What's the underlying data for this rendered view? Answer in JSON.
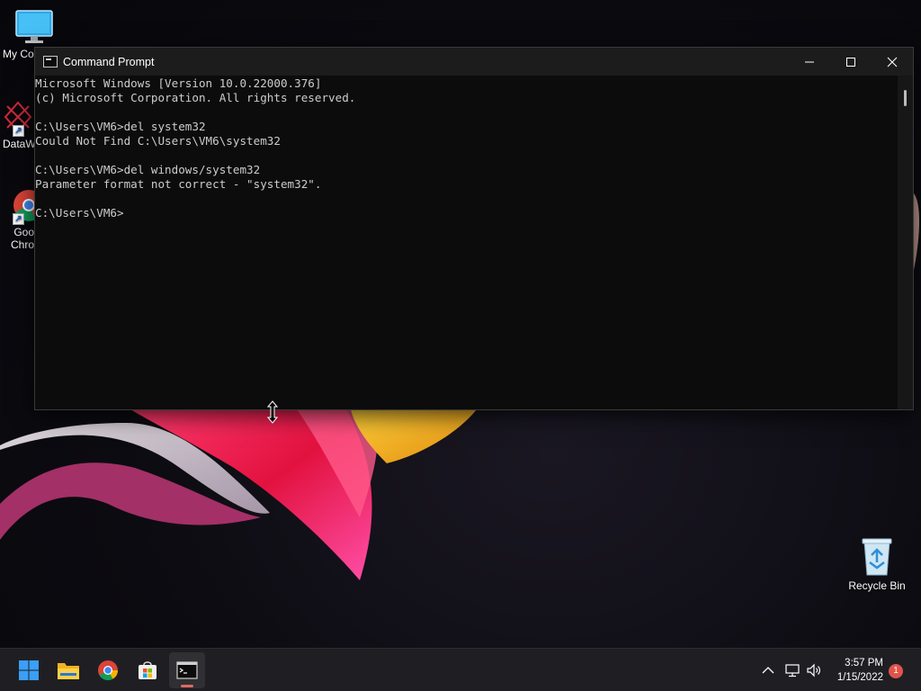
{
  "desktop": {
    "icons": [
      {
        "label": "My Co",
        "icon": "computer-icon"
      },
      {
        "label": "DataW",
        "icon": "datawrapper-icon"
      },
      {
        "label": "Goo",
        "label2": "Chro",
        "icon": "chrome-icon"
      },
      {
        "label": "Recycle Bin",
        "icon": "recycle-bin-icon"
      }
    ]
  },
  "window": {
    "title": "Command Prompt",
    "controls": [
      "minimize",
      "maximize",
      "close"
    ],
    "lines": [
      "Microsoft Windows [Version 10.0.22000.376]",
      "(c) Microsoft Corporation. All rights reserved.",
      "",
      "C:\\Users\\VM6>del system32",
      "Could Not Find C:\\Users\\VM6\\system32",
      "",
      "C:\\Users\\VM6>del windows/system32",
      "Parameter format not correct - \"system32\".",
      "",
      "C:\\Users\\VM6>"
    ]
  },
  "taskbar": {
    "apps": [
      {
        "name": "start",
        "icon": "windows-start-icon"
      },
      {
        "name": "file-explorer",
        "icon": "folder-icon"
      },
      {
        "name": "chrome",
        "icon": "chrome-icon"
      },
      {
        "name": "store",
        "icon": "store-icon"
      },
      {
        "name": "command-prompt",
        "icon": "terminal-icon",
        "active": true
      }
    ],
    "tray": [
      "chevron-up-icon",
      "network-icon",
      "volume-icon"
    ],
    "time": "3:57 PM",
    "date": "1/15/2022",
    "notification_count": "1"
  },
  "colors": {
    "console_bg": "#0c0c0c",
    "console_text": "#cccccc",
    "titlebar": "#1c1c1c",
    "taskbar": "#1f1f23"
  }
}
